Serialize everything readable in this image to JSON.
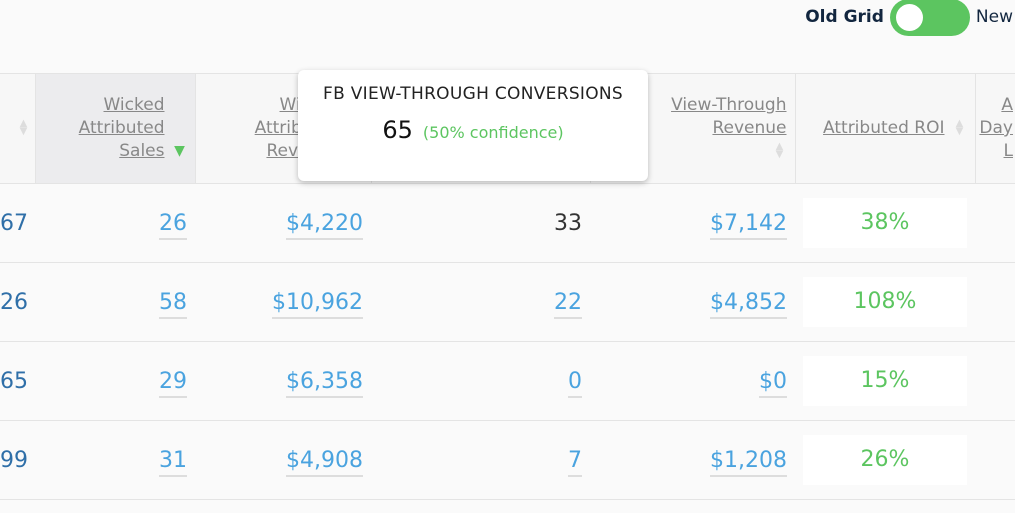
{
  "toggle": {
    "left_label": "Old Grid",
    "right_label": "New",
    "state": "Old Grid",
    "color": "#5cc560"
  },
  "columns": [
    {
      "label": "",
      "sort": "none"
    },
    {
      "label": "Wicked Attributed Sales",
      "sort": "descending"
    },
    {
      "label": "Wicked Attributed Revenue",
      "sort": "none"
    },
    {
      "label": "",
      "sort": "none"
    },
    {
      "label": "View-Through Revenue",
      "sort": "none"
    },
    {
      "label": "Attributed ROI",
      "sort": "none"
    },
    {
      "label": "A Day L",
      "sort": "none"
    }
  ],
  "rows": [
    [
      "67",
      "26",
      "$4,220",
      "33",
      "$7,142",
      "38%",
      ""
    ],
    [
      "26",
      "58",
      "$10,962",
      "22",
      "$4,852",
      "108%",
      ""
    ],
    [
      "65",
      "29",
      "$6,358",
      "0",
      "$0",
      "15%",
      ""
    ],
    [
      "99",
      "31",
      "$4,908",
      "7",
      "$1,208",
      "26%",
      ""
    ]
  ],
  "tooltip": {
    "title": "FB VIEW-THROUGH CONVERSIONS",
    "value": "65",
    "confidence": "(50% confidence)"
  }
}
